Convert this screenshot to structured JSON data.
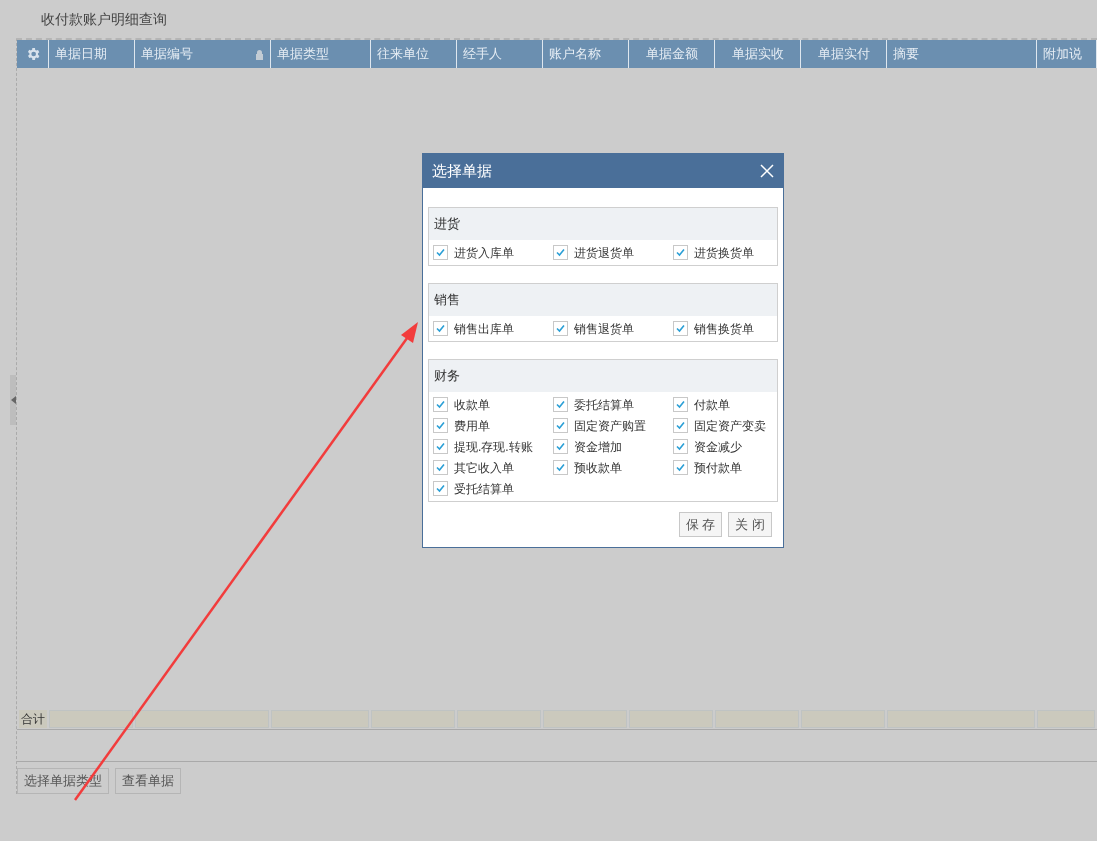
{
  "page_title": "收付款账户明细查询",
  "table": {
    "columns": [
      {
        "label": "单据日期",
        "locked": false
      },
      {
        "label": "单据编号",
        "locked": true
      },
      {
        "label": "单据类型",
        "locked": false
      },
      {
        "label": "往来单位",
        "locked": false
      },
      {
        "label": "经手人",
        "locked": false
      },
      {
        "label": "账户名称",
        "locked": false
      },
      {
        "label": "单据金额",
        "locked": false
      },
      {
        "label": "单据实收",
        "locked": false
      },
      {
        "label": "单据实付",
        "locked": false
      },
      {
        "label": "摘要",
        "locked": false
      },
      {
        "label": "附加说",
        "locked": false
      }
    ],
    "footer_label": "合计"
  },
  "buttons": [
    "选择单据类型",
    "查看单据"
  ],
  "dialog": {
    "title": "选择单据",
    "groups": [
      {
        "title": "进货",
        "items": [
          {
            "label": "进货入库单",
            "checked": true
          },
          {
            "label": "进货退货单",
            "checked": true
          },
          {
            "label": "进货换货单",
            "checked": true
          }
        ]
      },
      {
        "title": "销售",
        "items": [
          {
            "label": "销售出库单",
            "checked": true
          },
          {
            "label": "销售退货单",
            "checked": true
          },
          {
            "label": "销售换货单",
            "checked": true
          }
        ]
      },
      {
        "title": "财务",
        "items": [
          {
            "label": "收款单",
            "checked": true
          },
          {
            "label": "委托结算单",
            "checked": true
          },
          {
            "label": "付款单",
            "checked": true
          },
          {
            "label": "费用单",
            "checked": true
          },
          {
            "label": "固定资产购置",
            "checked": true
          },
          {
            "label": "固定资产变卖",
            "checked": true
          },
          {
            "label": "提现.存现.转账",
            "checked": true
          },
          {
            "label": "资金增加",
            "checked": true
          },
          {
            "label": "资金减少",
            "checked": true
          },
          {
            "label": "其它收入单",
            "checked": true
          },
          {
            "label": "预收款单",
            "checked": true
          },
          {
            "label": "预付款单",
            "checked": true
          },
          {
            "label": "受托结算单",
            "checked": true
          }
        ]
      }
    ],
    "buttons": [
      "保 存",
      "关 闭"
    ]
  }
}
